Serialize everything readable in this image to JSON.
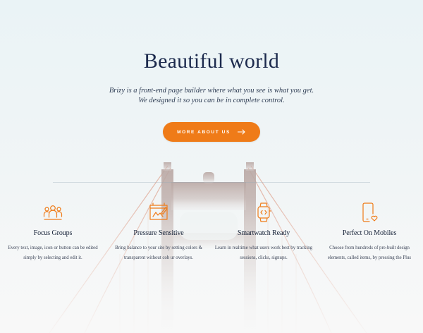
{
  "hero": {
    "title": "Beautiful world",
    "subtitle": "Brizy is a front-end page builder where what you see is what you get. We designed it so you can be in complete control.",
    "cta_label": "MORE ABOUT US"
  },
  "colors": {
    "accent": "#ef7b18",
    "heading": "#1c2a4d",
    "text": "#3a4356"
  },
  "features": [
    {
      "icon": "people-group-icon",
      "title": "Focus Groups",
      "description": "Every text, image, icon or button can be edited simply by selecting and edit it."
    },
    {
      "icon": "artboard-edit-icon",
      "title": "Pressure Sensitive",
      "description": "Bring balance to your site by setting colors & transparent without cob ur overlays."
    },
    {
      "icon": "smartwatch-code-icon",
      "title": "Smartwatch Ready",
      "description": "Learn in realtime what users work best by tracking sessions, clicks, signups."
    },
    {
      "icon": "mobile-heart-icon",
      "title": "Perfect On Mobiles",
      "description": "Choose from hundreds of pre-built design elements, called items, by pressing the Plus"
    }
  ]
}
